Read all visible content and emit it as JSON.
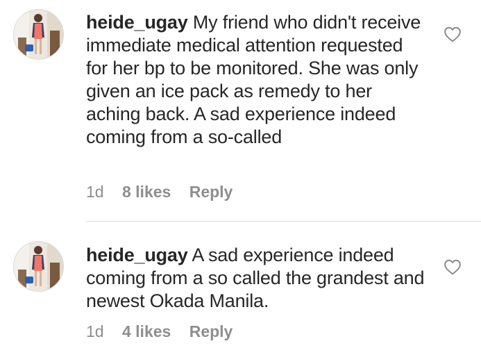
{
  "comments": [
    {
      "username": "heide_ugay",
      "text": "My friend who didn't receive immediate medical attention requested for her bp to be monitored. She was only given an ice pack as remedy to her aching back. A sad experience indeed coming from a so-called",
      "time": "1d",
      "likes": "8 likes",
      "reply_label": "Reply",
      "avatar_icon": "profile-photo-woman-pink-dress",
      "like_icon": "heart-outline-icon"
    },
    {
      "username": "heide_ugay",
      "text": "A sad experience indeed coming from a so called the grandest and newest Okada Manila.",
      "time": "1d",
      "likes": "4 likes",
      "reply_label": "Reply",
      "avatar_icon": "profile-photo-woman-pink-dress",
      "like_icon": "heart-outline-icon"
    }
  ],
  "colors": {
    "text": "#262626",
    "meta": "#8e8e8e",
    "divider": "#dbdbdb",
    "background": "#ffffff"
  }
}
